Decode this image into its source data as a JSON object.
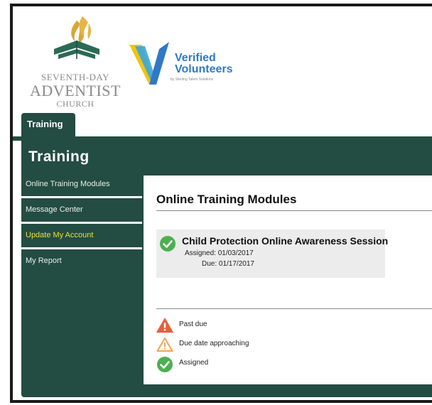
{
  "branding": {
    "sda_line1": "SEVENTH-DAY",
    "sda_line2": "ADVENTIST",
    "sda_line3": "CHURCH",
    "vv_line1": "Verified",
    "vv_line2": "Volunteers",
    "vv_tagline": "by Sterling Talent Solutions"
  },
  "tabs": [
    {
      "label": "Training"
    }
  ],
  "panel": {
    "title": "Training"
  },
  "nav": [
    {
      "label": "Online Training Modules"
    },
    {
      "label": "Message Center"
    },
    {
      "label": "Update My Account",
      "active": true
    },
    {
      "label": "My Report"
    }
  ],
  "content": {
    "title": "Online Training Modules",
    "modules": [
      {
        "name": "Child Protection Online Awareness Session",
        "assigned": "Assigned: 01/03/2017",
        "due": "Due: 01/17/2017",
        "status_icon": "check-circle-icon"
      }
    ],
    "legend": [
      {
        "label": "Past due",
        "icon": "warning-red-icon",
        "color": "#e5603e"
      },
      {
        "label": "Due date approaching",
        "icon": "warning-outline-icon",
        "color": "#f2a35b"
      },
      {
        "label": "Assigned",
        "icon": "check-circle-icon",
        "color": "#4caf50"
      }
    ]
  },
  "colors": {
    "panel": "#234c42",
    "active_nav": "#e6e236",
    "vv_blue": "#2f79c7",
    "vv_yellow": "#f2c40f"
  }
}
